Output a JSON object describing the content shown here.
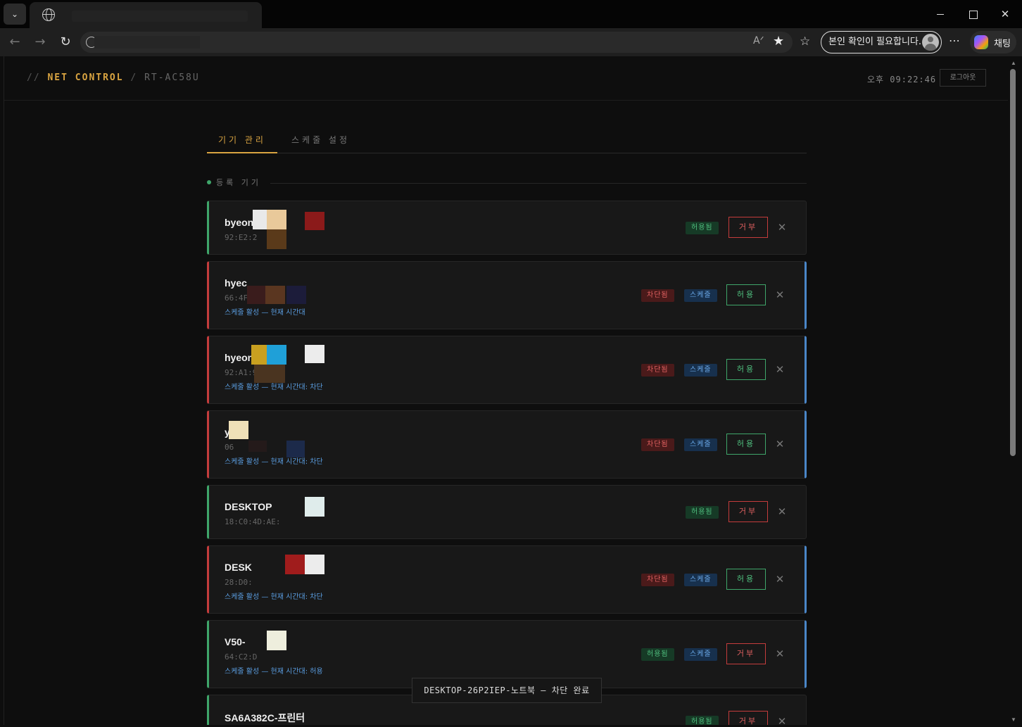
{
  "browser": {
    "profile_label": "본인 확인이 필요합니다.",
    "copilot_label": "채팅"
  },
  "header": {
    "prefix": "//",
    "brand": "NET CONTROL",
    "separator": "/",
    "device": "RT-AC58U",
    "clock": "오후 09:22:46",
    "logout_label": "로그아웃"
  },
  "tabs": [
    {
      "label": "기기 관리",
      "active": true
    },
    {
      "label": "스케줄 설정",
      "active": false
    }
  ],
  "section": {
    "label": "등록 기기"
  },
  "devices": [
    {
      "name": "byeon",
      "mac": "92:E2:2",
      "status": "허용됨",
      "schedule": null,
      "note": "",
      "action": "거부"
    },
    {
      "name": "hyec",
      "mac": "66:4F",
      "status": "차단됨",
      "schedule": "스케줄",
      "note": "스케줄 활성 — 현재 시간대",
      "action": "허용"
    },
    {
      "name": "hyeon",
      "mac": "92:A1:9",
      "status": "차단됨",
      "schedule": "스케줄",
      "note": "스케줄 활성 — 현재 시간대: 차단",
      "action": "허용"
    },
    {
      "name": "y",
      "mac": "06",
      "status": "차단됨",
      "schedule": "스케줄",
      "note": "스케줄 활성 — 현재 시간대: 차단",
      "action": "허용"
    },
    {
      "name": "DESKTOP",
      "mac": "18:C0:4D:AE:",
      "status": "허용됨",
      "schedule": null,
      "note": "",
      "action": "거부"
    },
    {
      "name": "DESK",
      "mac": "28:D0:",
      "status": "차단됨",
      "schedule": "스케줄",
      "note": "스케줄 활성 — 현재 시간대: 차단",
      "action": "허용"
    },
    {
      "name": "V50-",
      "mac": "64:C2:D",
      "status": "허용됨",
      "schedule": "스케줄",
      "note": "스케줄 활성 — 현재 시간대: 허용",
      "action": "거부"
    },
    {
      "name": "SA6A382C-프린터",
      "mac": "",
      "status": "허용됨",
      "schedule": null,
      "note": "",
      "action": "거부"
    }
  ],
  "toast": "DESKTOP-26P2IEP-노트북 — 차단 완료",
  "colors": {
    "accent": "#d9a441",
    "allowed": "#3fa66a",
    "blocked": "#c43c3c",
    "schedule": "#4a86c7"
  }
}
